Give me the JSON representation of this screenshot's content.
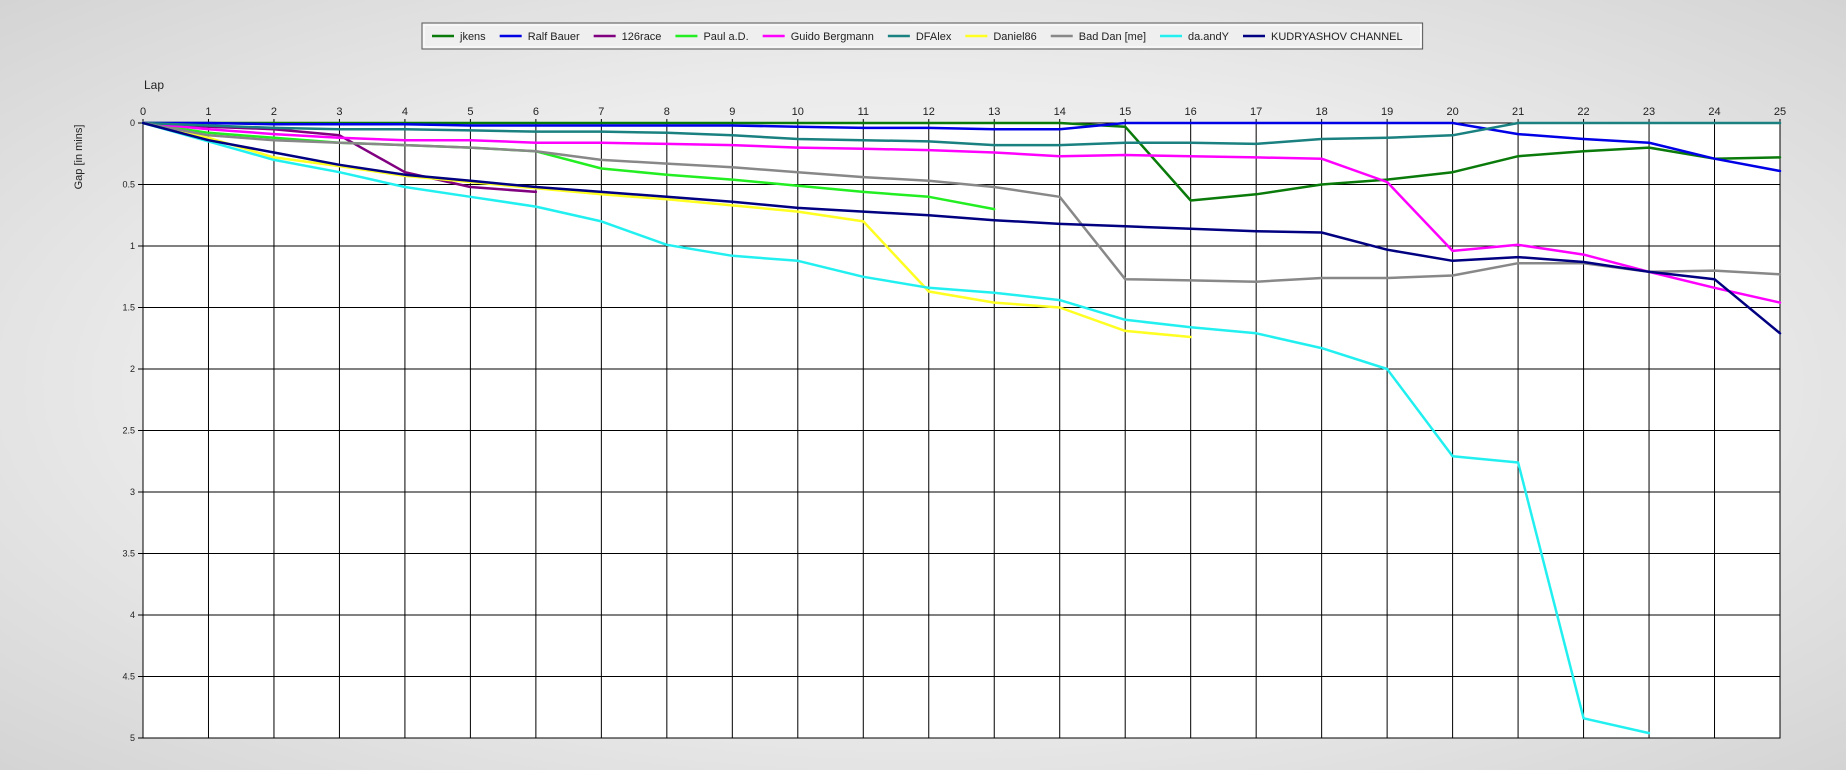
{
  "chart_data": {
    "type": "line",
    "title": "",
    "xlabel": "Lap",
    "ylabel": "Gap [in mins]",
    "xlim": [
      0,
      25
    ],
    "ylim": [
      0,
      5
    ],
    "y_inverted": true,
    "x_axis_position": "top",
    "grid": true,
    "legend_position": "top-center",
    "x_ticks": [
      "0",
      "1",
      "2",
      "3",
      "4",
      "5",
      "6",
      "7",
      "8",
      "9",
      "10",
      "11",
      "12",
      "13",
      "14",
      "15",
      "16",
      "17",
      "18",
      "19",
      "20",
      "21",
      "22",
      "23",
      "24",
      "25"
    ],
    "y_ticks": [
      {
        "value": 0,
        "label": "0"
      },
      {
        "value": 0.5,
        "label": "0.5"
      },
      {
        "value": 1,
        "label": "1"
      },
      {
        "value": 1.5,
        "label": "1.5"
      },
      {
        "value": 2,
        "label": "2"
      },
      {
        "value": 2.5,
        "label": "2.5"
      },
      {
        "value": 3,
        "label": "3"
      },
      {
        "value": 3.5,
        "label": "3.5"
      },
      {
        "value": 4,
        "label": "4"
      },
      {
        "value": 4.5,
        "label": "4.5"
      },
      {
        "value": 5,
        "label": "5"
      }
    ],
    "series": [
      {
        "name": "jkens",
        "color": "#0a7a0a",
        "x": [
          0,
          14,
          15,
          16,
          17,
          18,
          19,
          20,
          21,
          22,
          23,
          24,
          25
        ],
        "y": [
          0,
          0,
          0.03,
          0.63,
          0.58,
          0.5,
          0.46,
          0.4,
          0.27,
          0.23,
          0.2,
          0.29,
          0.28
        ]
      },
      {
        "name": "Ralf Bauer",
        "color": "#0000e6",
        "x": [
          0,
          1,
          2,
          3,
          4,
          5,
          6,
          7,
          8,
          9,
          10,
          11,
          12,
          13,
          14,
          15,
          16,
          17,
          18,
          19,
          20,
          21,
          22,
          23,
          24,
          25
        ],
        "y": [
          0,
          0,
          0.01,
          0.01,
          0.01,
          0.02,
          0.02,
          0.02,
          0.02,
          0.02,
          0.03,
          0.04,
          0.04,
          0.05,
          0.05,
          0,
          0,
          0,
          0,
          0,
          0,
          0.09,
          0.13,
          0.16,
          0.29,
          0.39
        ]
      },
      {
        "name": "126race",
        "color": "#800080",
        "x": [
          0,
          1,
          2,
          3,
          4,
          5,
          6
        ],
        "y": [
          0,
          0.03,
          0.05,
          0.1,
          0.4,
          0.52,
          0.56
        ]
      },
      {
        "name": "Paul a.D.",
        "color": "#22ee22",
        "x": [
          0,
          1,
          2,
          3,
          4,
          5,
          6,
          7,
          8,
          9,
          10,
          11,
          12,
          13
        ],
        "y": [
          0,
          0.08,
          0.12,
          0.16,
          0.18,
          0.2,
          0.23,
          0.37,
          0.42,
          0.46,
          0.51,
          0.56,
          0.6,
          0.7
        ]
      },
      {
        "name": "Guido Bergmann",
        "color": "#ff00ff",
        "x": [
          0,
          1,
          2,
          3,
          4,
          5,
          6,
          7,
          8,
          9,
          10,
          11,
          12,
          13,
          14,
          15,
          16,
          17,
          18,
          19,
          20,
          21,
          22,
          23,
          24,
          25
        ],
        "y": [
          0,
          0.05,
          0.09,
          0.12,
          0.14,
          0.14,
          0.16,
          0.16,
          0.17,
          0.18,
          0.2,
          0.21,
          0.22,
          0.24,
          0.27,
          0.26,
          0.27,
          0.28,
          0.29,
          0.48,
          1.04,
          0.99,
          1.07,
          1.21,
          1.34,
          1.46
        ]
      },
      {
        "name": "DFAlex",
        "color": "#1a8080",
        "x": [
          0,
          1,
          2,
          3,
          4,
          5,
          6,
          7,
          8,
          9,
          10,
          11,
          12,
          13,
          14,
          15,
          16,
          17,
          18,
          19,
          20,
          21,
          22,
          23,
          24,
          25
        ],
        "y": [
          0,
          0.02,
          0.04,
          0.05,
          0.05,
          0.06,
          0.07,
          0.07,
          0.08,
          0.1,
          0.13,
          0.14,
          0.15,
          0.18,
          0.18,
          0.16,
          0.16,
          0.17,
          0.13,
          0.12,
          0.1,
          0,
          0,
          0,
          0,
          0
        ]
      },
      {
        "name": "Daniel86",
        "color": "#ffff22",
        "x": [
          0,
          1,
          2,
          3,
          4,
          5,
          6,
          7,
          8,
          9,
          10,
          11,
          12,
          13,
          14,
          15,
          16
        ],
        "y": [
          0,
          0.12,
          0.28,
          0.35,
          0.43,
          0.48,
          0.53,
          0.58,
          0.62,
          0.67,
          0.72,
          0.8,
          1.37,
          1.46,
          1.5,
          1.69,
          1.74
        ]
      },
      {
        "name": "Bad Dan [me]",
        "color": "#888888",
        "x": [
          0,
          1,
          2,
          3,
          4,
          5,
          6,
          7,
          8,
          9,
          10,
          11,
          12,
          13,
          14,
          15,
          16,
          17,
          18,
          19,
          20,
          21,
          22,
          23,
          24,
          25
        ],
        "y": [
          0,
          0.1,
          0.14,
          0.16,
          0.18,
          0.2,
          0.23,
          0.3,
          0.33,
          0.36,
          0.4,
          0.44,
          0.47,
          0.52,
          0.6,
          1.27,
          1.28,
          1.29,
          1.26,
          1.26,
          1.24,
          1.14,
          1.14,
          1.21,
          1.2,
          1.23
        ]
      },
      {
        "name": "da.andY",
        "color": "#22f0f0",
        "x": [
          0,
          1,
          2,
          3,
          4,
          5,
          6,
          7,
          8,
          9,
          10,
          11,
          12,
          13,
          14,
          15,
          16,
          17,
          18,
          19,
          20,
          21,
          22,
          23
        ],
        "y": [
          0,
          0.15,
          0.3,
          0.4,
          0.52,
          0.6,
          0.68,
          0.8,
          0.99,
          1.08,
          1.12,
          1.25,
          1.34,
          1.38,
          1.44,
          1.6,
          1.66,
          1.71,
          1.83,
          2,
          2.71,
          2.76,
          4.84,
          4.96
        ]
      },
      {
        "name": "KUDRYASHOV CHANNEL",
        "color": "#000080",
        "x": [
          0,
          1,
          2,
          3,
          4,
          5,
          6,
          7,
          8,
          9,
          10,
          11,
          12,
          13,
          14,
          15,
          16,
          17,
          18,
          19,
          20,
          21,
          22,
          23,
          24,
          25
        ],
        "y": [
          0,
          0.14,
          0.24,
          0.34,
          0.42,
          0.47,
          0.52,
          0.56,
          0.6,
          0.64,
          0.69,
          0.72,
          0.75,
          0.79,
          0.82,
          0.84,
          0.86,
          0.88,
          0.89,
          1.03,
          1.12,
          1.09,
          1.13,
          1.21,
          1.27,
          1.71
        ]
      }
    ]
  }
}
